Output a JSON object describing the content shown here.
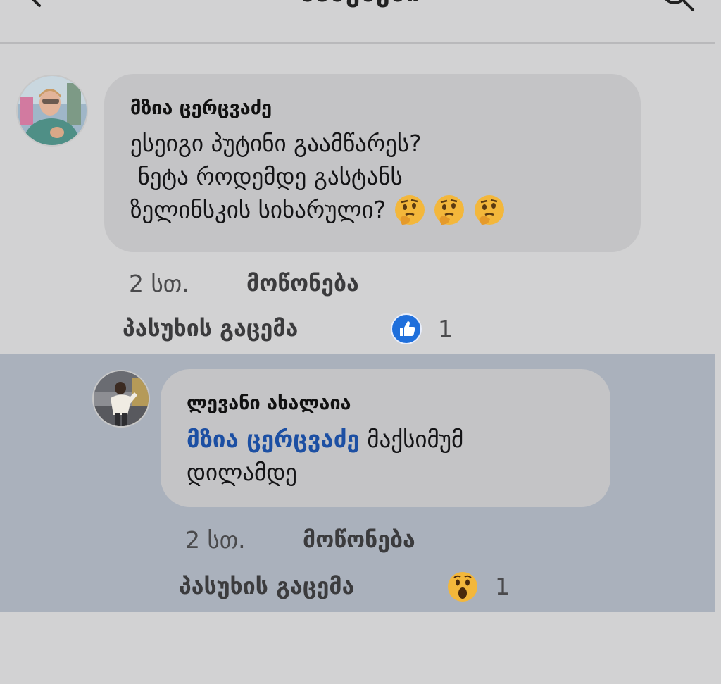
{
  "header": {
    "title": "პასუხები",
    "back_icon": "arrow-left-icon",
    "search_icon": "search-icon"
  },
  "comment": {
    "author": "მზია ცერცვაძე",
    "lines": [
      "ესეიგი პუტინი გაამწარეს?",
      " ნეტა როდემდე გასტანს",
      "ზელინსკის სიხარული?"
    ],
    "emojis": [
      "🤔",
      "🤔",
      "🤔"
    ],
    "time": "2 სთ.",
    "like_label": "მოწონება",
    "reply_label": "პასუხის გაცემა",
    "reaction_icon": "like-icon",
    "reaction_count": "1"
  },
  "reply": {
    "author": "ლევანი ახალაია",
    "mention": "მზია ცერცვაძე",
    "text_line1": " მაქსიმუმ",
    "text_line2": "დილამდე",
    "time": "2 სთ.",
    "like_label": "მოწონება",
    "reply_label": "პასუხის გაცემა",
    "reaction_icon": "wow-icon",
    "reaction_count": "1"
  },
  "colors": {
    "page_bg": "#d2d2d3",
    "bubble_bg": "#c4c4c6",
    "highlight_bg": "#aab1bc",
    "mention": "#1c4fa3",
    "like_blue": "#1f6fdb"
  }
}
